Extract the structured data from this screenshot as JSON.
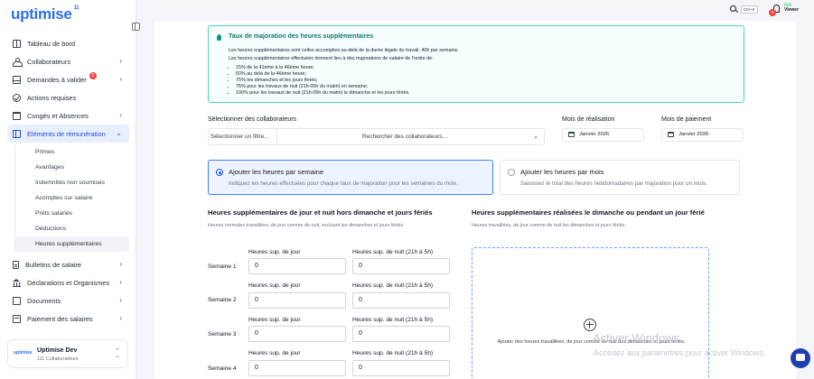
{
  "app": {
    "logo": "uptimise",
    "logo_tm": "11"
  },
  "sidebar": {
    "items": [
      {
        "label": "Tableau de bord",
        "icon": "dashboard-icon",
        "chevron": false
      },
      {
        "label": "Collaborateurs",
        "icon": "people-icon",
        "chevron": true
      },
      {
        "label": "Demandes à valider",
        "icon": "inbox-icon",
        "chevron": true,
        "badge": "5"
      },
      {
        "label": "Actions requises",
        "icon": "check-circle-icon",
        "chevron": false
      },
      {
        "label": "Congés et Absences",
        "icon": "calendar-icon",
        "chevron": true
      },
      {
        "label": "Eléments de rémunération",
        "icon": "payroll-card-icon",
        "chevron": true,
        "active": true
      }
    ],
    "subitems": [
      "Primes",
      "Avantages",
      "Indemnités non soumises",
      "Acomptes sur salaire",
      "Prêts salariés",
      "Déductions",
      "Heures supplémentaires"
    ],
    "items_after": [
      {
        "label": "Bulletins de salaire",
        "icon": "payslip-icon"
      },
      {
        "label": "Déclarations et Organismes",
        "icon": "bank-icon"
      },
      {
        "label": "Documents",
        "icon": "folder-icon"
      },
      {
        "label": "Paiement des salaires",
        "icon": "payment-icon"
      }
    ],
    "org": {
      "logo": "uptimise",
      "name": "Uptimise Dev",
      "count": "111 Collaborateurs"
    }
  },
  "topbar": {
    "shortcut": "Ctrl+K",
    "notifications": "0",
    "user_logo_line1": "ikin",
    "user_logo_line2": "Viewer"
  },
  "info": {
    "title": "Taux de majoration des heures supplémentaires",
    "line1": "Les heures supplémentaires sont celles accomplies au-delà de la durée légale du travail, 40h par semaine.",
    "line2": "Les heures supplémentaires effectuées donnent lieu à des majorations de salaire de l'ordre de:",
    "bullets": [
      "15% de la 41ème à la 46ème heure;",
      "50% au delà de la 46ème heure;",
      "75% les dimanches et les jours fériés;",
      "75% pour les travaux de nuit (21h-05h du matin) en semaine;",
      "100% pour les travaux de nuit (21h-05h du matin) le dimanche et les jours fériés."
    ]
  },
  "filters": {
    "collab_label": "Sélectionner des collaborateurs",
    "filter_placeholder": "Sélectionner un filtre...",
    "search_placeholder": "Rechercher des collaborateurs...",
    "realisation_label": "Mois de réalisation",
    "realisation_value": "Janvier 2026",
    "paiement_label": "Mois de paiement",
    "paiement_value": "Janvier 2026"
  },
  "modes": [
    {
      "title": "Ajouter les heures par semaine",
      "desc": "Indiquez les heures effectuées pour chaque taux de majoration pour les semaines du mois.",
      "selected": true
    },
    {
      "title": "Ajouter les heures par mois",
      "desc": "Saisissez le total des heures hebdomadaires par majoration pour un mois.",
      "selected": false
    }
  ],
  "left_section": {
    "title": "Heures supplémentaires de jour et nuit hors dimanche et jours fériés",
    "desc": "Heures normales travaillées, de jour comme de nuit, excluant les dimanches et jours fériés.",
    "col_day": "Heures sup. de jour",
    "col_night": "Heures sup. de nuit (21h à 5h)",
    "weeks": [
      {
        "label": "Semaine 1",
        "day": "0",
        "night": "0"
      },
      {
        "label": "Semaine 2",
        "day": "0",
        "night": "0"
      },
      {
        "label": "Semaine 3",
        "day": "0",
        "night": "0"
      },
      {
        "label": "Semaine 4",
        "day": "0",
        "night": "0"
      }
    ]
  },
  "right_section": {
    "title": "Heures supplémentaires réalisées le dimanche ou pendant un jour férié",
    "desc": "Heures travaillées, de jour comme de nuit les dimanches et jours fériés.",
    "add_text": "Ajouter des heures travaillées, de jour comme de nuit des dimanches et jours fériés."
  },
  "watermark": {
    "line1": "Activer Windows",
    "line2": "Accédez aux paramètres pour activer Windows."
  },
  "colors": {
    "accent": "#1d4ed8",
    "brand": "#2f6fe0",
    "info_border": "#4fd1c5",
    "badge": "#ef4444"
  }
}
